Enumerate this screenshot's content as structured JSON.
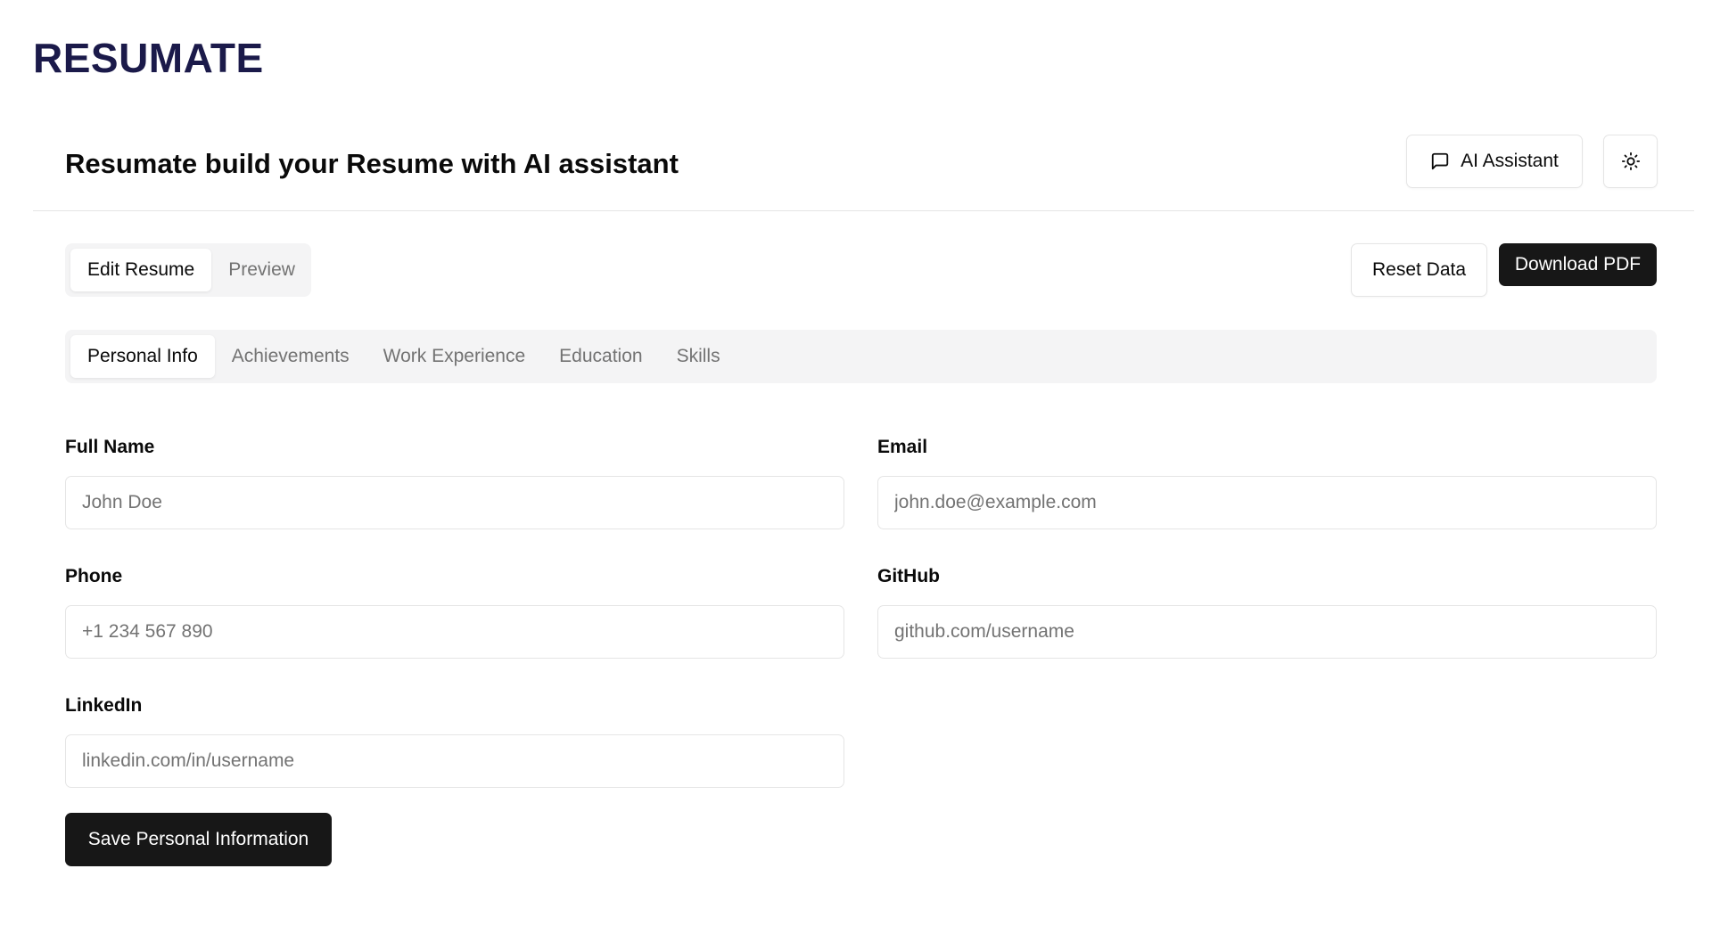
{
  "brand": {
    "name": "RESUMATE",
    "color": "#1b1a4a"
  },
  "header": {
    "title": "Resumate build your Resume with AI assistant",
    "ai_assistant_label": "AI Assistant",
    "ai_assistant_icon": "message-square-icon",
    "theme_toggle_icon": "sun-icon"
  },
  "mode_tabs": {
    "items": [
      {
        "label": "Edit Resume",
        "active": true
      },
      {
        "label": "Preview",
        "active": false
      }
    ]
  },
  "actions": {
    "reset_label": "Reset Data",
    "download_label": "Download PDF"
  },
  "section_tabs": {
    "items": [
      {
        "label": "Personal Info",
        "active": true
      },
      {
        "label": "Achievements",
        "active": false
      },
      {
        "label": "Work Experience",
        "active": false
      },
      {
        "label": "Education",
        "active": false
      },
      {
        "label": "Skills",
        "active": false
      }
    ]
  },
  "form": {
    "full_name": {
      "label": "Full Name",
      "placeholder": "John Doe",
      "value": ""
    },
    "email": {
      "label": "Email",
      "placeholder": "john.doe@example.com",
      "value": ""
    },
    "phone": {
      "label": "Phone",
      "placeholder": "+1 234 567 890",
      "value": ""
    },
    "github": {
      "label": "GitHub",
      "placeholder": "github.com/username",
      "value": ""
    },
    "linkedin": {
      "label": "LinkedIn",
      "placeholder": "linkedin.com/in/username",
      "value": ""
    },
    "save_label": "Save Personal Information"
  },
  "colors": {
    "primary_dark": "#171717",
    "muted_bg": "#f4f4f5",
    "border": "#e5e5e5",
    "muted_text": "#737373"
  }
}
